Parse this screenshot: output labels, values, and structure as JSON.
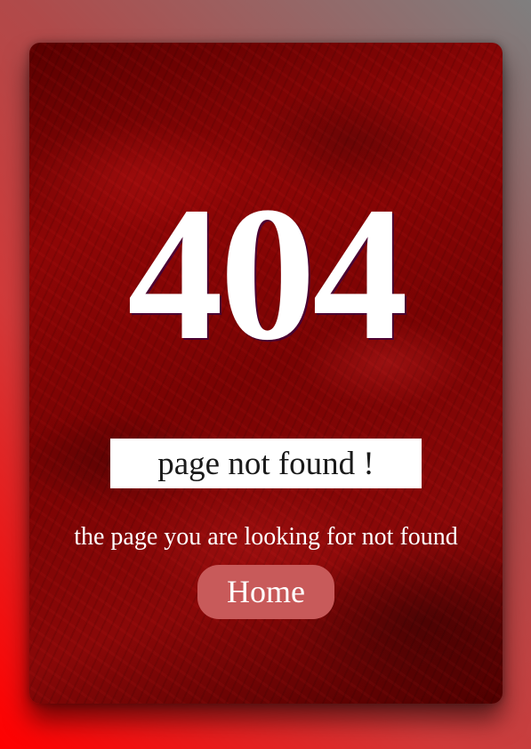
{
  "error_page": {
    "code": "404",
    "subtitle": "page not found !",
    "message": "the page you are looking for not found",
    "home_label": "Home"
  },
  "colors": {
    "background_gradient_start": "#ff0000",
    "background_gradient_end": "#7f7f7f",
    "card_base": "#8e0606",
    "button": "#c85a5a",
    "text": "#ffffff",
    "subtitle_text": "#1a1a1a"
  }
}
